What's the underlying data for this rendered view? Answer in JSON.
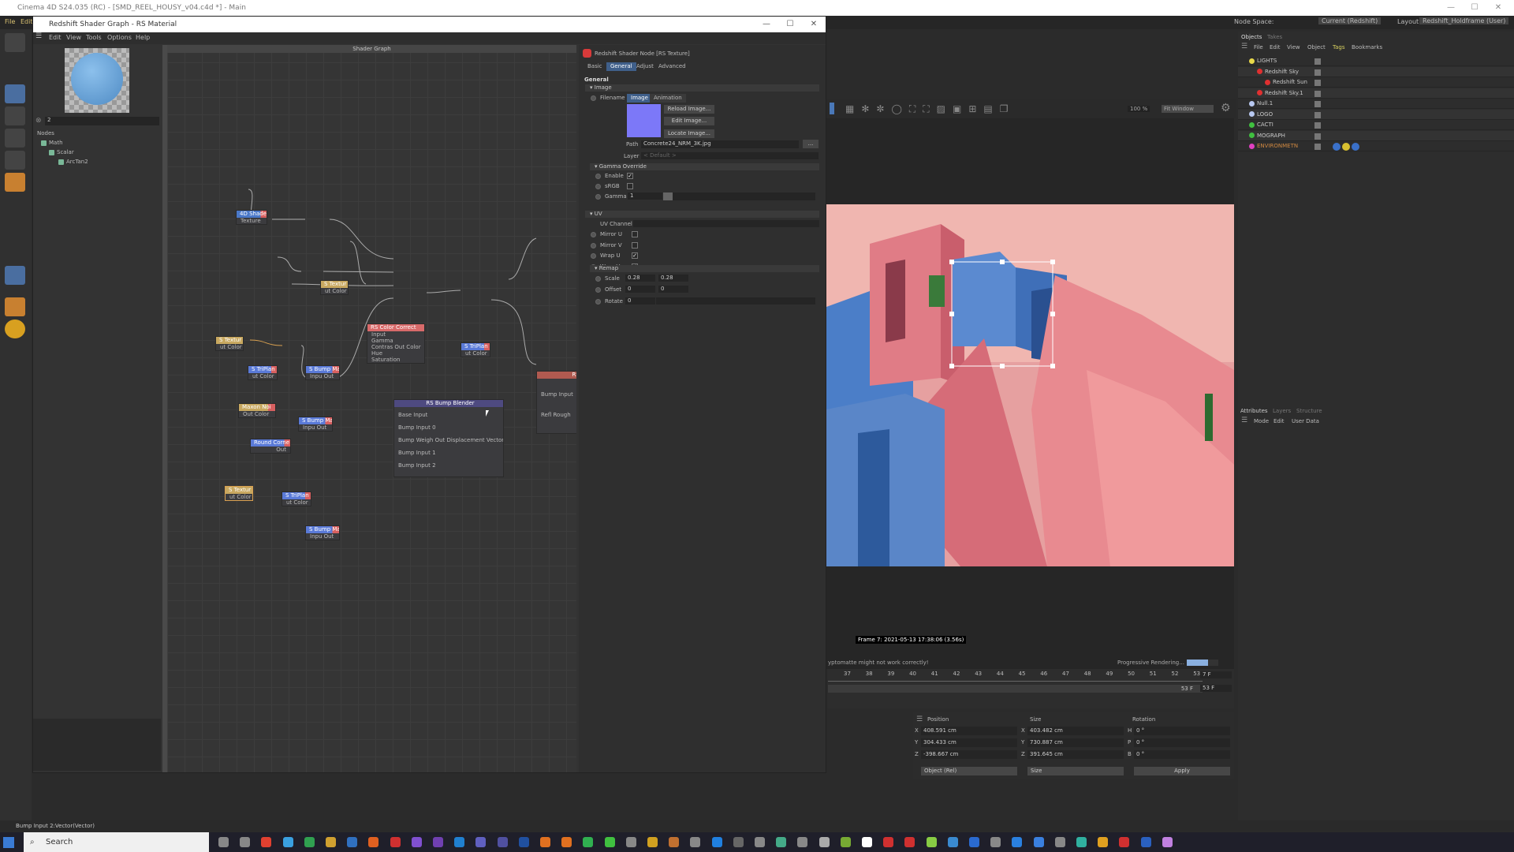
{
  "app": {
    "title": "Cinema 4D S24.035 (RC) - [SMD_REEL_HOUSY_v04.c4d *] - Main",
    "menu": [
      "File",
      "Edit"
    ],
    "node_space_label": "Node Space:",
    "node_space_value": "Current (Redshift)",
    "layout_label": "Layout:",
    "layout_value": "Redshift_Holdframe (User)"
  },
  "shader_graph": {
    "title": "Redshift Shader Graph - RS Material",
    "menu": [
      "Edit",
      "View",
      "Tools",
      "Options",
      "Help"
    ],
    "search_value": "2",
    "nodes_header": "Nodes",
    "tree": [
      "Math",
      "Scalar",
      "ArcTan2"
    ],
    "canvas_title": "Shader Graph"
  },
  "graph_nodes": {
    "shader4d": {
      "title": "4D Shade",
      "ports": [
        "Texture"
      ]
    },
    "tex1": {
      "title": "S Textur",
      "ports": [
        "ut Color"
      ]
    },
    "cc": {
      "title": "RS Color Correct",
      "ports": [
        "Input",
        "Gamma",
        "Contras Out Color",
        "Hue",
        "Saturation"
      ]
    },
    "tri_r": {
      "title": "S TriPlan",
      "ports": [
        "ut Color"
      ]
    },
    "tex2": {
      "title": "S Textur",
      "ports": [
        "ut Color"
      ]
    },
    "tri1": {
      "title": "S TriPlan",
      "ports": [
        "ut Color"
      ]
    },
    "bump1": {
      "title": "S Bump Ma",
      "ports": [
        "Inpu Out"
      ]
    },
    "noise": {
      "title": "Maxon Noi",
      "ports": [
        "Out Color"
      ]
    },
    "bump2": {
      "title": "S Bump Ma",
      "ports": [
        "Inpu Out"
      ]
    },
    "round": {
      "title": "Round Corne",
      "ports": [
        "Out"
      ]
    },
    "blender": {
      "title": "RS Bump Blender",
      "ports": [
        "Base Input",
        "Bump Input 0",
        "Bump Weigh  Out Displacement Vector",
        "Bump Input 1",
        "Bump Input 2"
      ]
    },
    "rs": {
      "title": "RS I",
      "ports": [
        "Bump Input",
        "Refl Rough"
      ]
    },
    "tex3": {
      "title": "S Textur",
      "ports": [
        "ut Color"
      ]
    },
    "tri3": {
      "title": "S TriPlan",
      "ports": [
        "ut Color"
      ]
    },
    "bump3": {
      "title": "S Bump Ma",
      "ports": [
        "Inpu Out"
      ]
    }
  },
  "attributes": {
    "title": "Redshift Shader Node [RS Texture]",
    "tabs": [
      "Basic",
      "General",
      "Adjust",
      "Advanced"
    ],
    "active_tab": "General",
    "section": "General",
    "image": {
      "label": "Image",
      "filename_label": "Filename",
      "subtabs": [
        "Image",
        "Animation"
      ],
      "buttons": [
        "Reload Image...",
        "Edit Image...",
        "Locate Image..."
      ],
      "path_label": "Path",
      "path_value": "Concrete24_NRM_3K.jpg",
      "browse": "...",
      "layer_label": "Layer",
      "layer_value": "< Default >"
    },
    "gamma": {
      "label": "Gamma Override",
      "enable_label": "Enable",
      "enable": true,
      "srgb_label": "sRGB",
      "srgb": false,
      "gamma_label": "Gamma",
      "gamma_value": "1"
    },
    "uv": {
      "label": "UV",
      "channel_label": "UV Channel",
      "mirror_u_label": "Mirror U",
      "mirror_u": false,
      "mirror_v_label": "Mirror V",
      "mirror_v": false,
      "wrap_u_label": "Wrap U",
      "wrap_u": true,
      "wrap_v_label": "Wrap V",
      "wrap_v": true
    },
    "remap": {
      "label": "Remap",
      "scale_label": "Scale",
      "scale_x": "0.28",
      "scale_y": "0.28",
      "offset_label": "Offset",
      "offset_x": "0",
      "offset_y": "0",
      "rotate_label": "Rotate",
      "rotate": "0"
    }
  },
  "viewport": {
    "zoom": "100 %",
    "fit": "Fit Window",
    "frame_info": "Frame  7:  2021-05-13  17:38:06  (3.56s)",
    "warning": "yptomatte might not work correctly!",
    "progress_label": "Progressive Rendering...",
    "progress_pct": 67
  },
  "timeline": {
    "ticks": [
      "37",
      "38",
      "39",
      "40",
      "41",
      "42",
      "43",
      "44",
      "45",
      "46",
      "47",
      "48",
      "49",
      "50",
      "51",
      "52",
      "53"
    ],
    "current": "7 F",
    "end": "53 F",
    "end2": "53 F"
  },
  "coords": {
    "headers": [
      "Position",
      "Size",
      "Rotation"
    ],
    "pos": [
      [
        "X",
        "408.591 cm"
      ],
      [
        "Y",
        "304.433 cm"
      ],
      [
        "Z",
        "-398.667 cm"
      ]
    ],
    "size": [
      [
        "X",
        "403.482 cm"
      ],
      [
        "Y",
        "730.887 cm"
      ],
      [
        "Z",
        "391.645 cm"
      ]
    ],
    "rot": [
      [
        "H",
        "0 °"
      ],
      [
        "P",
        "0 °"
      ],
      [
        "B",
        "0 °"
      ]
    ],
    "mode": "Object (Rel)",
    "size_mode": "Size",
    "apply": "Apply"
  },
  "objects": {
    "tabs": [
      "Objects",
      "Takes"
    ],
    "menu": [
      "File",
      "Edit",
      "View",
      "Object",
      "Tags",
      "Bookmarks"
    ],
    "items": [
      {
        "name": "LIGHTS",
        "color": "#e8d84a"
      },
      {
        "name": "Redshift Sky",
        "color": "#e03030"
      },
      {
        "name": "Redshift Sun",
        "color": "#e03030"
      },
      {
        "name": "Redshift Sky.1",
        "color": "#e03030"
      },
      {
        "name": "Null.1",
        "color": "#b8c8f0"
      },
      {
        "name": "LOGO",
        "color": "#b8c8f0"
      },
      {
        "name": "CACTI",
        "color": "#40c040"
      },
      {
        "name": "MOGRAPH",
        "color": "#40c040"
      },
      {
        "name": "ENVIRONMETN",
        "color": "#e040c0"
      }
    ]
  },
  "attr_manager": {
    "tabs": [
      "Attributes",
      "Layers",
      "Structure"
    ],
    "menu": [
      "Mode",
      "Edit",
      "User Data"
    ]
  },
  "status": "Bump Input 2:Vector(Vector)",
  "taskbar": {
    "search": "Search"
  },
  "colors": {
    "accent": "#4a78b8",
    "header_red": "#d86060",
    "sky_pink": "#e88a90",
    "wall_blue": "#5a86c8"
  }
}
